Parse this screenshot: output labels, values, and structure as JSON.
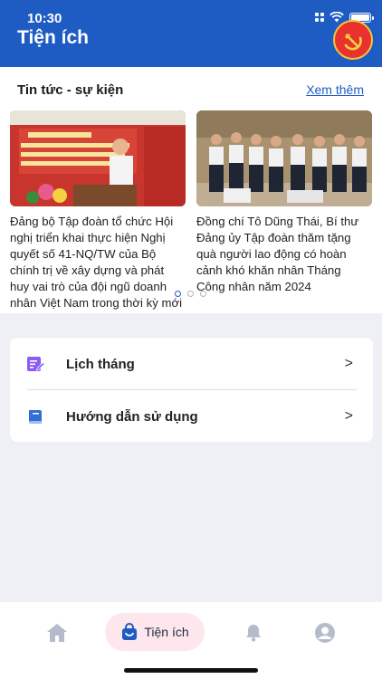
{
  "status_bar": {
    "time": "10:30"
  },
  "header": {
    "title": "Tiện ích"
  },
  "news": {
    "section_title": "Tin tức - sự kiện",
    "see_more": "Xem thêm",
    "items": [
      {
        "caption": "Đảng bộ Tập đoàn tổ chức Hội nghị triển khai thực hiện Nghị quyết số 41-NQ/TW của Bộ chính trị về xây dựng và phát huy vai trò của đội ngũ doanh nhân Việt Nam trong thời kỳ mới"
      },
      {
        "caption": "Đồng chí Tô Dũng Thái, Bí thư Đảng ủy Tập đoàn thăm tặng quà người lao động có hoàn cảnh khó khăn nhân Tháng Công nhân năm 2024"
      }
    ],
    "pager": {
      "count": 3,
      "active": 0
    }
  },
  "menu": {
    "items": [
      {
        "label": "Lịch tháng",
        "icon": "edit-calendar-icon"
      },
      {
        "label": "Hướng dẫn sử dụng",
        "icon": "book-icon"
      }
    ],
    "chevron": ">"
  },
  "bottom_nav": {
    "active_label": "Tiện ích",
    "items": [
      "home-icon",
      "bag-icon",
      "bell-icon",
      "profile-icon"
    ]
  },
  "colors": {
    "primary": "#1e5cc4",
    "active_tab_bg": "#fde7ec",
    "emblem_red": "#e8322e"
  }
}
